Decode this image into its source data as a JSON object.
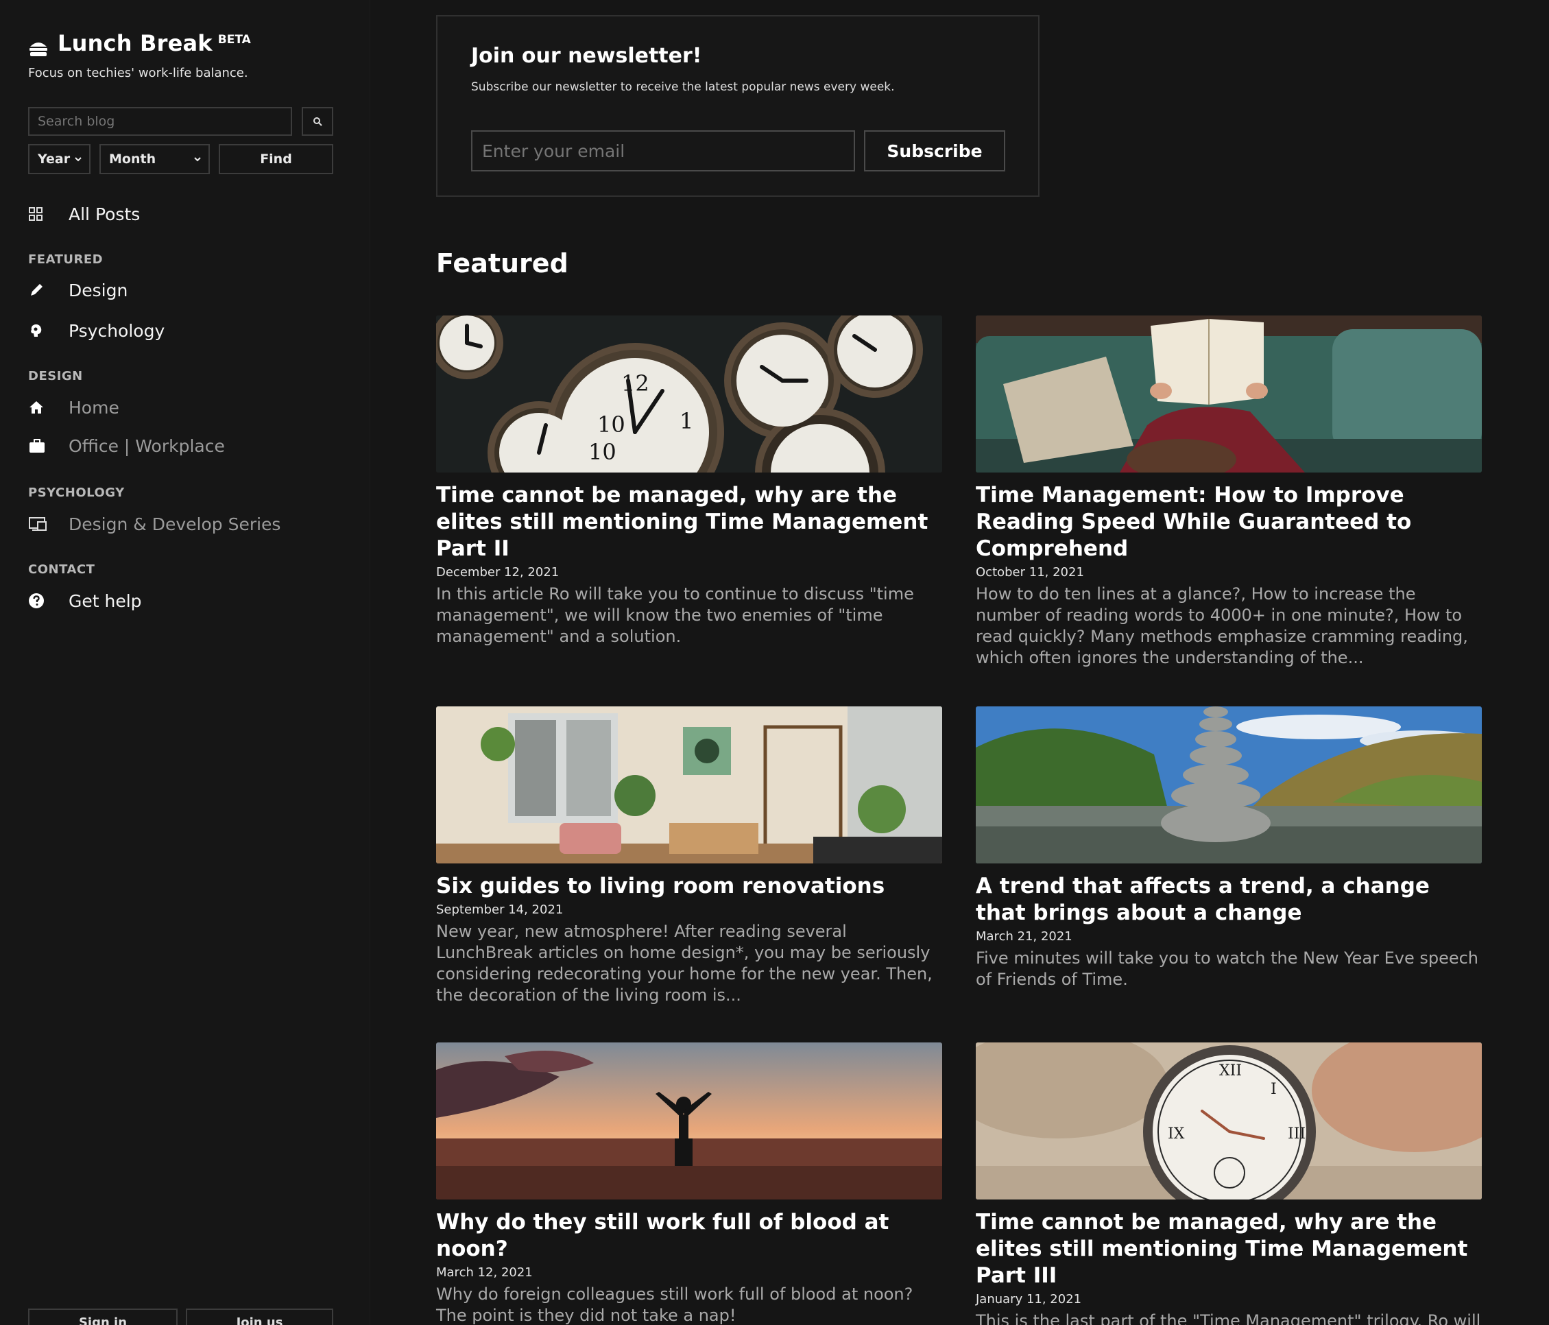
{
  "brand": {
    "name": "Lunch Break",
    "badge": "BETA",
    "tagline": "Focus on techies' work-life balance."
  },
  "search": {
    "placeholder": "Search blog",
    "year_label": "Year",
    "month_label": "Month",
    "find_label": "Find"
  },
  "nav": {
    "all_posts": "All Posts",
    "sections": [
      {
        "heading": "FEATURED",
        "items": [
          {
            "label": "Design",
            "icon": "pencil-icon"
          },
          {
            "label": "Psychology",
            "icon": "brain-icon"
          }
        ]
      },
      {
        "heading": "DESIGN",
        "items": [
          {
            "label": "Home",
            "icon": "home-icon"
          },
          {
            "label": "Office | Workplace",
            "icon": "briefcase-icon"
          }
        ]
      },
      {
        "heading": "PSYCHOLOGY",
        "items": [
          {
            "label": "Design & Develop Series",
            "icon": "devices-icon"
          }
        ]
      },
      {
        "heading": "CONTACT",
        "items": [
          {
            "label": "Get help",
            "icon": "question-icon"
          }
        ]
      }
    ]
  },
  "footer": {
    "left_button": "Sign in",
    "right_button": "Join us"
  },
  "newsletter": {
    "title": "Join our newsletter!",
    "subtitle": "Subscribe our newsletter to receive the latest popular news every week.",
    "email_placeholder": "Enter your email",
    "button": "Subscribe"
  },
  "featured": {
    "heading": "Featured",
    "posts": [
      {
        "title": "Time cannot be managed, why are the elites still mentioning Time Management Part II",
        "date": "December 12, 2021",
        "excerpt": "In this article Ro will take you to continue to discuss \"time management\", we will know the two enemies of \"time management\" and a solution.",
        "image": "clocks"
      },
      {
        "title": "Time Management: How to Improve Reading Speed While Guaranteed to Comprehend",
        "date": "October 11, 2021",
        "excerpt": "How to do ten lines at a glance?, How to increase the number of reading words to 4000+ in one minute?, How to read quickly? Many methods emphasize cramming reading, which often ignores the understanding of the...",
        "image": "reading"
      },
      {
        "title": "Six guides to living room renovations",
        "date": "September 14, 2021",
        "excerpt": "New year, new atmosphere! After reading several LunchBreak articles on home design*, you may be seriously considering redecorating your home for the new year. Then, the decoration of the living room is...",
        "image": "living-room"
      },
      {
        "title": "A trend that affects a trend, a change that brings about a change",
        "date": "March 21, 2021",
        "excerpt": "Five minutes will take you to watch the New Year Eve speech of Friends of Time.",
        "image": "stones"
      },
      {
        "title": "Why do they still work full of blood at noon?",
        "date": "March 12, 2021",
        "excerpt": "Why do foreign colleagues still work full of blood at noon? The point is they did not take a nap!",
        "image": "sunset"
      },
      {
        "title": "Time cannot be managed, why are the elites still mentioning Time Management Part III",
        "date": "January 11, 2021",
        "excerpt": "This is the last part of the \"Time Management\" trilogy. Ro will explain two core concepts: PRIORITIZING and",
        "image": "pocket-watch"
      }
    ]
  }
}
